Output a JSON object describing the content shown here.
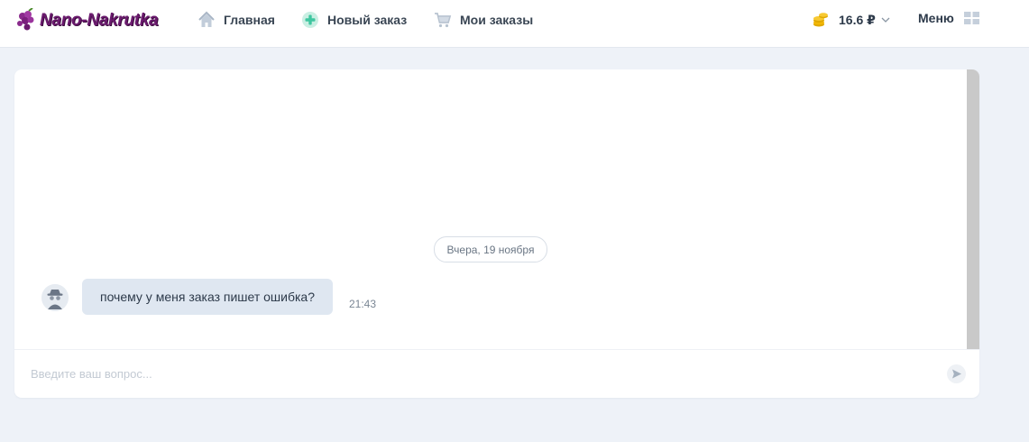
{
  "brand": {
    "name": "Nano-Nakrutka"
  },
  "nav": {
    "home": "Главная",
    "new_order": "Новый заказ",
    "my_orders": "Мои заказы"
  },
  "balance": {
    "amount": "16.6 ₽"
  },
  "menu": {
    "label": "Меню"
  },
  "chat": {
    "date_separator": "Вчера, 19 ноября",
    "messages": [
      {
        "text": "почему у меня заказ пишет ошибка?",
        "time": "21:43"
      }
    ],
    "input_placeholder": "Введите ваш вопрос..."
  },
  "colors": {
    "brand": "#6b1a6e",
    "new_order_icon": "#3fc6a0",
    "coins": "#f2b705",
    "bubble": "#dfe7f1",
    "page_bg": "#eef2f8"
  },
  "icons": {
    "home": "home-icon",
    "new_order": "plus-circle-icon",
    "my_orders": "cart-icon",
    "balance": "coins-icon",
    "menu": "grid-icon",
    "send": "send-icon",
    "avatar": "incognito-avatar-icon"
  }
}
